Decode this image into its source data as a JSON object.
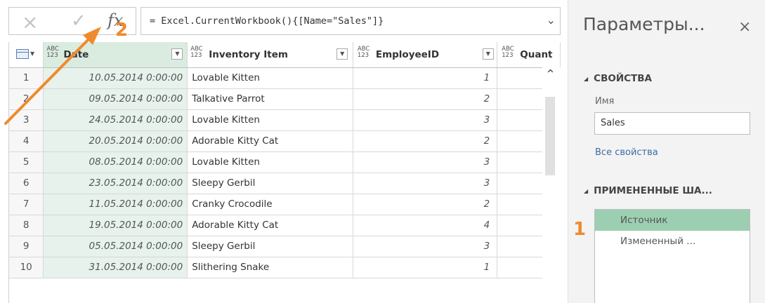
{
  "formula_bar": {
    "cancel_icon": "×",
    "confirm_icon": "✓",
    "fx_label": "fx",
    "formula": "= Excel.CurrentWorkbook(){[Name=\"Sales\"]}",
    "expand_icon": "chevron-down-icon"
  },
  "grid": {
    "type_badge_top": "ABC",
    "type_badge_bottom": "123",
    "columns": [
      "Date",
      "Inventory Item",
      "EmployeeID",
      "Quant"
    ],
    "rows": [
      {
        "n": "1",
        "date": "10.05.2014 0:00:00",
        "item": "Lovable Kitten",
        "emp": "1"
      },
      {
        "n": "2",
        "date": "09.05.2014 0:00:00",
        "item": "Talkative Parrot",
        "emp": "2"
      },
      {
        "n": "3",
        "date": "24.05.2014 0:00:00",
        "item": "Lovable Kitten",
        "emp": "3"
      },
      {
        "n": "4",
        "date": "20.05.2014 0:00:00",
        "item": "Adorable Kitty Cat",
        "emp": "2"
      },
      {
        "n": "5",
        "date": "08.05.2014 0:00:00",
        "item": "Lovable Kitten",
        "emp": "3"
      },
      {
        "n": "6",
        "date": "23.05.2014 0:00:00",
        "item": "Sleepy Gerbil",
        "emp": "3"
      },
      {
        "n": "7",
        "date": "11.05.2014 0:00:00",
        "item": "Cranky Crocodile",
        "emp": "2"
      },
      {
        "n": "8",
        "date": "19.05.2014 0:00:00",
        "item": "Adorable Kitty Cat",
        "emp": "4"
      },
      {
        "n": "9",
        "date": "05.05.2014 0:00:00",
        "item": "Sleepy Gerbil",
        "emp": "3"
      },
      {
        "n": "10",
        "date": "31.05.2014 0:00:00",
        "item": "Slithering Snake",
        "emp": "1"
      }
    ]
  },
  "pane": {
    "title": "Параметры...",
    "close_icon": "×",
    "properties_heading": "СВОЙСТВА",
    "name_label": "Имя",
    "name_value": "Sales",
    "all_properties_link": "Все свойства",
    "steps_heading": "ПРИМЕНЕННЫЕ ША...",
    "steps": [
      "Источник",
      "Измененный ..."
    ]
  },
  "annotations": {
    "marker_1": "1",
    "marker_2": "2",
    "arrow_color": "#f08a2c"
  }
}
